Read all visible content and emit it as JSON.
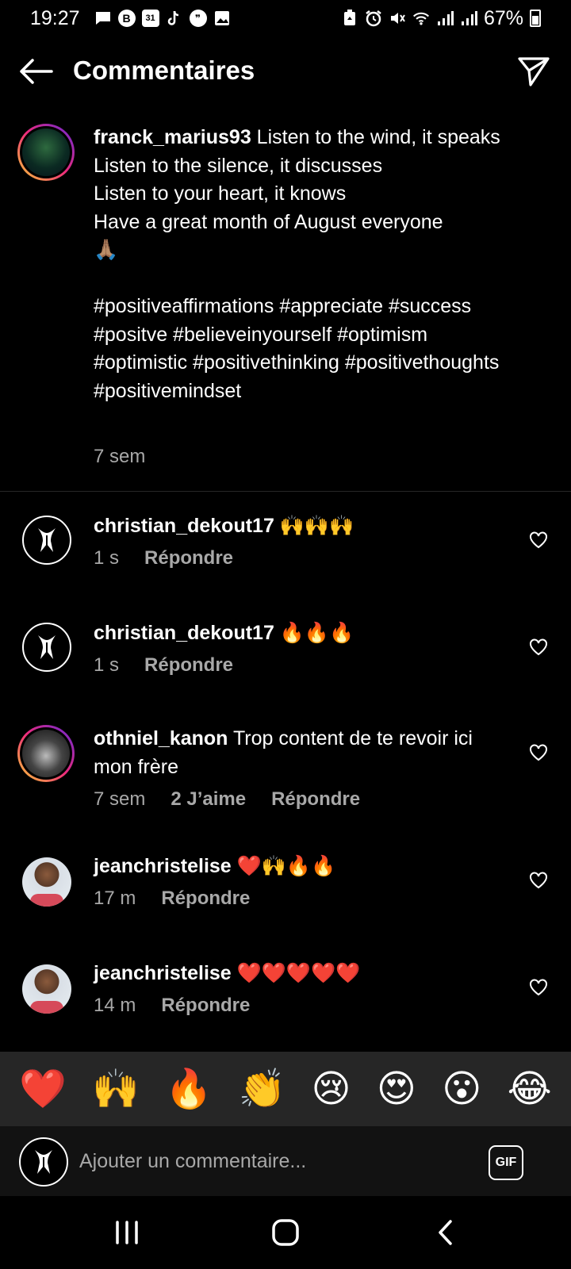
{
  "status_bar": {
    "time": "19:27",
    "left_icons": [
      "message-icon",
      "b-app-icon",
      "calendar-31-icon",
      "tiktok-icon",
      "quote-icon",
      "gallery-icon"
    ],
    "calendar_day": "31",
    "right_icons": [
      "recycle-icon",
      "alarm-icon",
      "mute-icon",
      "wifi-icon",
      "signal-icon",
      "signal-icon",
      "battery-icon"
    ],
    "battery_percent": "67%"
  },
  "header": {
    "title": "Commentaires",
    "back_icon": "arrow-left-icon",
    "send_icon": "paper-plane-icon"
  },
  "caption": {
    "username": "franck_marius93",
    "text": " Listen to the wind, it speaks\nListen to the silence, it discusses\nListen to your heart, it knows\nHave a great month of August everyone\n🙏🏽\n\n#positiveaffirmations #appreciate #success #positve #believeinyourself #optimism #optimistic #positivethinking #positivethoughts #positivemindset",
    "time": "7 sem"
  },
  "comments": [
    {
      "username": "christian_dekout17",
      "text": " 🙌🙌🙌",
      "time": "1 s",
      "likes": "",
      "reply": "Répondre"
    },
    {
      "username": "christian_dekout17",
      "text": " 🔥🔥🔥",
      "time": "1 s",
      "likes": "",
      "reply": "Répondre"
    },
    {
      "username": "othniel_kanon",
      "text": " Trop content de te revoir ici mon frère",
      "time": "7 sem",
      "likes": "2 J’aime",
      "reply": "Répondre"
    },
    {
      "username": "jeanchristelise",
      "text": " ❤️🙌🔥🔥",
      "time": "17 m",
      "likes": "",
      "reply": "Répondre"
    },
    {
      "username": "jeanchristelise",
      "text": " ❤️❤️❤️❤️❤️",
      "time": "14 m",
      "likes": "",
      "reply": "Répondre"
    }
  ],
  "emoji_bar": [
    "❤️",
    "🙌",
    "🔥",
    "👏",
    "😢",
    "😍",
    "😮",
    "😂"
  ],
  "input": {
    "placeholder": "Ajouter un commentaire...",
    "gif_label": "GIF"
  },
  "nav_bar": {
    "recents_icon": "recents-icon",
    "home_icon": "home-icon",
    "back_icon": "back-chevron-icon"
  }
}
